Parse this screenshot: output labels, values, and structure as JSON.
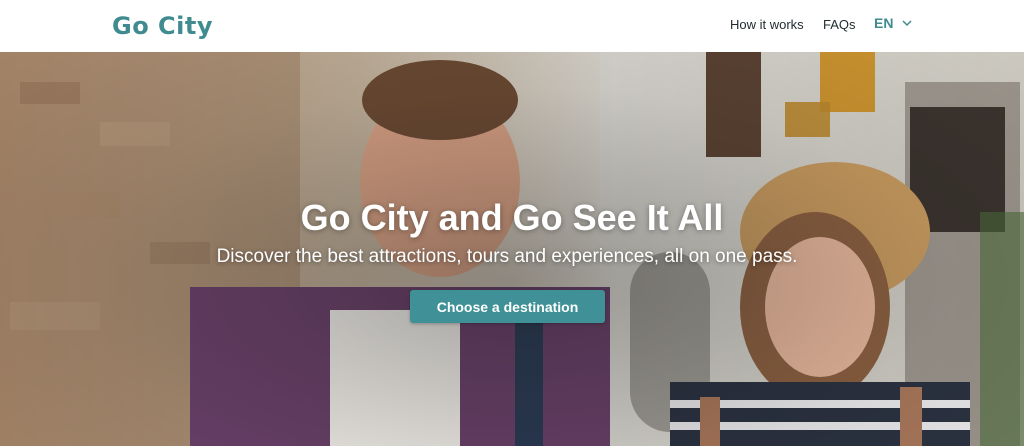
{
  "header": {
    "logo_text": "Go City",
    "nav": {
      "how_it_works": "How it works",
      "faqs": "FAQs"
    },
    "language": {
      "selected": "EN"
    }
  },
  "hero": {
    "headline": "Go City and Go See It All",
    "subheadline": "Discover the best attractions, tours and experiences, all on one pass.",
    "cta_label": "Choose a destination"
  },
  "colors": {
    "brand_teal": "#3f9197",
    "text_dark": "#1f2a2e",
    "white": "#ffffff"
  }
}
